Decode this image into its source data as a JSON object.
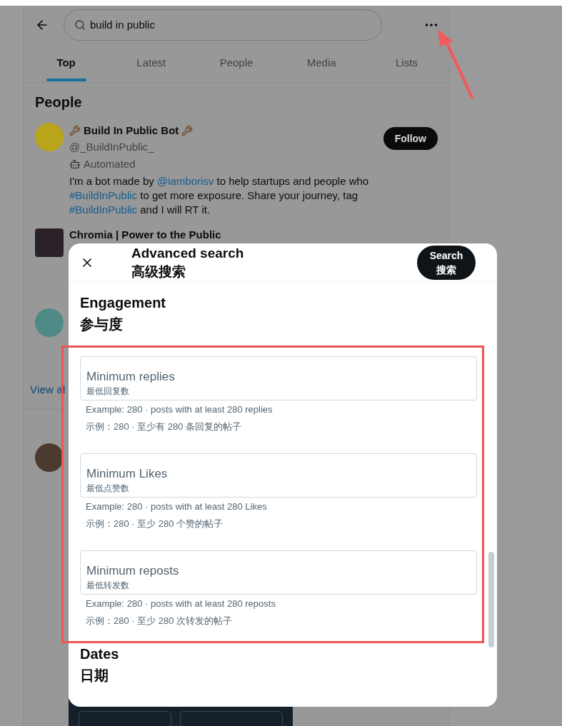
{
  "search_bar": {
    "query": "build in public"
  },
  "tabs": [
    {
      "label": "Top",
      "selected": true
    },
    {
      "label": "Latest",
      "selected": false
    },
    {
      "label": "People",
      "selected": false
    },
    {
      "label": "Media",
      "selected": false
    },
    {
      "label": "Lists",
      "selected": false
    }
  ],
  "people": {
    "title": "People",
    "items": [
      {
        "name": "Build In Public Bot",
        "handle": "@_BuildInPublic_",
        "automated": "Automated",
        "follow": "Follow",
        "color": "#b8a51c",
        "bio": [
          {
            "kind": "text",
            "text": "I'm a bot made by "
          },
          {
            "kind": "link",
            "text": "@iamborisv"
          },
          {
            "kind": "text",
            "text": " to help startups and people who "
          },
          {
            "kind": "link",
            "text": "#BuildInPublic"
          },
          {
            "kind": "text",
            "text": " to get more exposure. Share your journey, tag "
          },
          {
            "kind": "link",
            "text": "#BuildInPublic"
          },
          {
            "kind": "text",
            "text": " and I will RT it."
          }
        ]
      },
      {
        "name": "Chromia | Power to the Public",
        "color": "#2a2228"
      },
      {
        "color": "#4f8a86"
      },
      {
        "color": "#4a3a30"
      }
    ],
    "view_all": "View al"
  },
  "modal": {
    "title": "Advanced search",
    "title_zh": "高级搜索",
    "search_button": "Search",
    "search_button_zh": "搜索",
    "sections": [
      {
        "title": "Engagement",
        "title_zh": "参与度",
        "fields": [
          {
            "label": "Minimum replies",
            "label_zh": "最低回复数",
            "hint": "Example: 280 · posts with at least 280 replies",
            "hint_zh": "示例：280 · 至少有 280 条回复的帖子"
          },
          {
            "label": "Minimum Likes",
            "label_zh": "最低点赞数",
            "hint": "Example: 280 · posts with at least 280 Likes",
            "hint_zh": "示例：280 · 至少 280 个赞的帖子"
          },
          {
            "label": "Minimum reposts",
            "label_zh": "最低转发数",
            "hint": "Example: 280 · posts with at least 280 reposts",
            "hint_zh": "示例：280 · 至少 280 次转发的帖子"
          }
        ]
      },
      {
        "title": "Dates",
        "title_zh": "日期"
      }
    ]
  }
}
